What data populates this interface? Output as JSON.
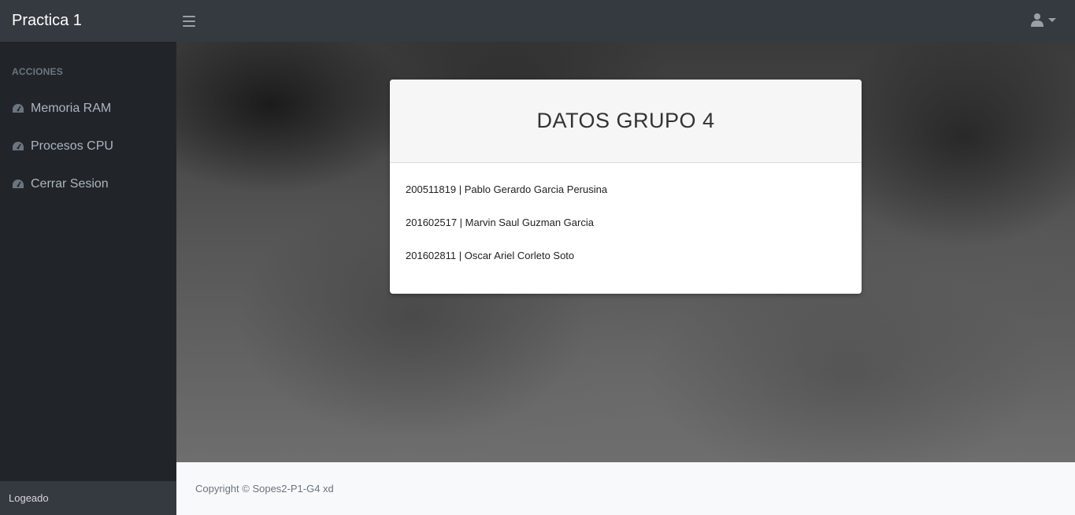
{
  "app": {
    "brand": "Practica 1"
  },
  "sidebar": {
    "heading": "ACCIONES",
    "items": [
      {
        "label": "Memoria RAM",
        "icon": "dashboard-icon"
      },
      {
        "label": "Procesos CPU",
        "icon": "dashboard-icon"
      },
      {
        "label": "Cerrar Sesion",
        "icon": "dashboard-icon"
      }
    ],
    "footer": "Logeado"
  },
  "card": {
    "title": "DATOS GRUPO 4",
    "members": [
      "200511819 | Pablo Gerardo Garcia Perusina",
      "201602517 | Marvin Saul Guzman Garcia",
      "201602811 | Oscar Ariel Corleto Soto"
    ]
  },
  "footer": {
    "copyright": "Copyright © Sopes2-P1-G4 xd"
  },
  "colors": {
    "topbar": "#343a40",
    "sidebar": "#212529",
    "footer": "#f8f9fa"
  }
}
